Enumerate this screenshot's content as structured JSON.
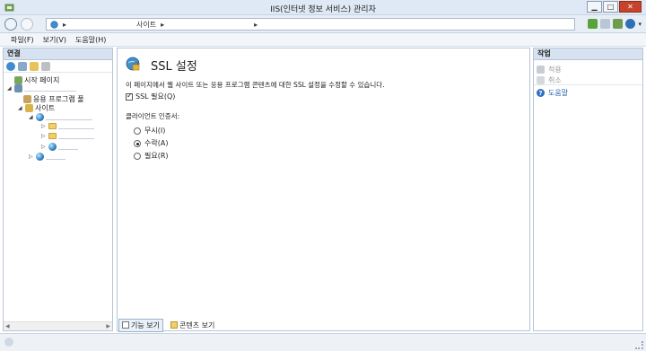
{
  "window": {
    "title": "IIS(인터넷 정보 서비스) 관리자",
    "controls": [
      "minimize",
      "maximize",
      "close"
    ]
  },
  "address": {
    "segments": [
      "▸",
      "사이트",
      "▸",
      "▸"
    ]
  },
  "menu": {
    "items": [
      "파일(F)",
      "보기(V)",
      "도움말(H)"
    ]
  },
  "connections": {
    "header": "연결",
    "tree": {
      "start_page": "시작 페이지",
      "app_pools": "응용 프로그램 풀",
      "sites": "사이트"
    }
  },
  "feature": {
    "title": "SSL 설정",
    "description": "이 페이지에서 웹 사이트 또는 응용 프로그램 콘텐츠에 대한 SSL 설정을 수정할 수 있습니다.",
    "require_ssl_label": "SSL 필요(Q)",
    "require_ssl_checked": true,
    "client_cert_label": "클라이언트 인증서:",
    "client_cert_options": [
      "무시(I)",
      "수락(A)",
      "필요(R)"
    ],
    "client_cert_selected": "수락(A)"
  },
  "view_tabs": {
    "features": "기능 보기",
    "content": "콘텐츠 보기"
  },
  "actions": {
    "header": "작업",
    "apply": "적용",
    "cancel": "취소",
    "help": "도움말"
  }
}
